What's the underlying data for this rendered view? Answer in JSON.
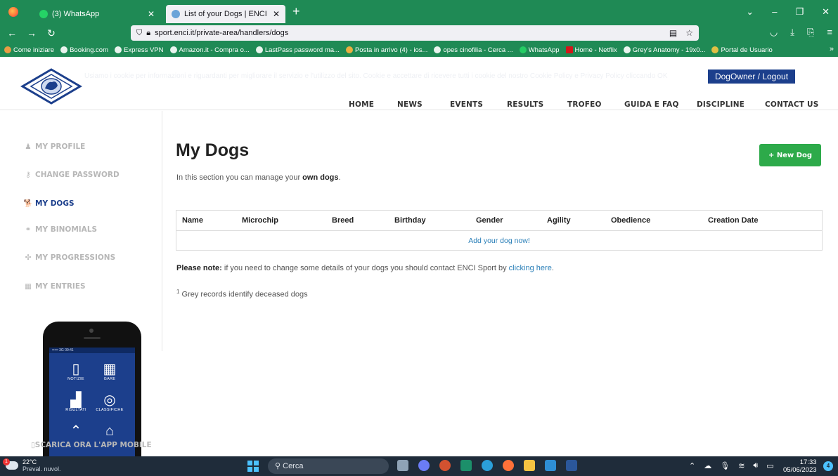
{
  "browser": {
    "tabs": [
      {
        "label": "(3) WhatsApp",
        "active": false
      },
      {
        "label": "List of your Dogs | ENCI Sport",
        "active": true
      }
    ],
    "url": "sport.enci.it/private-area/handlers/dogs",
    "bookmarks": [
      "Come iniziare",
      "Booking.com",
      "Express VPN",
      "Amazon.it - Compra o...",
      "LastPass password ma...",
      "Posta in arrivo (4) - ios...",
      "opes cinofilia - Cerca ...",
      "WhatsApp",
      "Home - Netflix",
      "Grey's Anatomy - 19x0...",
      "Portal de Usuario"
    ],
    "more": "»"
  },
  "header": {
    "cookie_text": "Usiamo i cookie per informazioni e riguardanti per migliorare il servizio e l'utilizzo del sito. Cookie e accettare di ricevere tutti i cookie del nostro Cookie Policy e Privacy Policy cliccando OK",
    "owner_button": "DogOwner / Logout",
    "nav": [
      "HOME",
      "NEWS",
      "EVENTS",
      "RESULTS",
      "TROFEO",
      "GUIDA E FAQ",
      "DISCIPLINE",
      "CONTACT US"
    ]
  },
  "sidebar": {
    "items": [
      {
        "label": "MY PROFILE",
        "icon": "user-icon",
        "glyph": "♟",
        "active": false
      },
      {
        "label": "CHANGE PASSWORD",
        "icon": "key-icon",
        "glyph": "⚷",
        "active": false
      },
      {
        "label": "MY DOGS",
        "icon": "dog-icon",
        "glyph": "🐕",
        "active": true
      },
      {
        "label": "MY BINOMIALS",
        "icon": "link-icon",
        "glyph": "⚭",
        "active": false
      },
      {
        "label": "MY PROGRESSIONS",
        "icon": "puzzle-icon",
        "glyph": "✣",
        "active": false
      },
      {
        "label": "MY ENTRIES",
        "icon": "calendar-icon",
        "glyph": "▦",
        "active": false
      }
    ],
    "app_download": "SCARICA ORA L'APP MOBILE",
    "phone_tiles": [
      "NOTIZIE",
      "GARE",
      "RISULTATI",
      "CLASSIFICHE"
    ]
  },
  "main": {
    "title": "My Dogs",
    "intro_prefix": "In this section you can manage your ",
    "intro_bold": "own dogs",
    "intro_suffix": ".",
    "new_button": "+ New Dog",
    "table": {
      "columns": [
        "Name",
        "Microchip",
        "Breed",
        "Birthday",
        "Gender",
        "Agility",
        "Obedience",
        "Creation Date"
      ],
      "empty_link": "Add your dog now!"
    },
    "note_bold": "Please note:",
    "note_text": " if you need to change some details of your dogs you should contact ENCI Sport by ",
    "note_link": "clicking here",
    "note_end": ".",
    "footnote_sup": "1",
    "footnote": " Grey records identify deceased dogs"
  },
  "taskbar": {
    "weather_temp": "22°C",
    "weather_desc": "Preval. nuvol.",
    "weather_badge": "1",
    "search_placeholder": "Cerca",
    "time": "17:33",
    "date": "05/06/2023",
    "notification_count": "4"
  },
  "colors": {
    "browser_chrome": "#1f8a55",
    "brand_blue": "#1c3f8c",
    "button_green": "#2daa4a",
    "link_blue": "#2a7fb8"
  }
}
